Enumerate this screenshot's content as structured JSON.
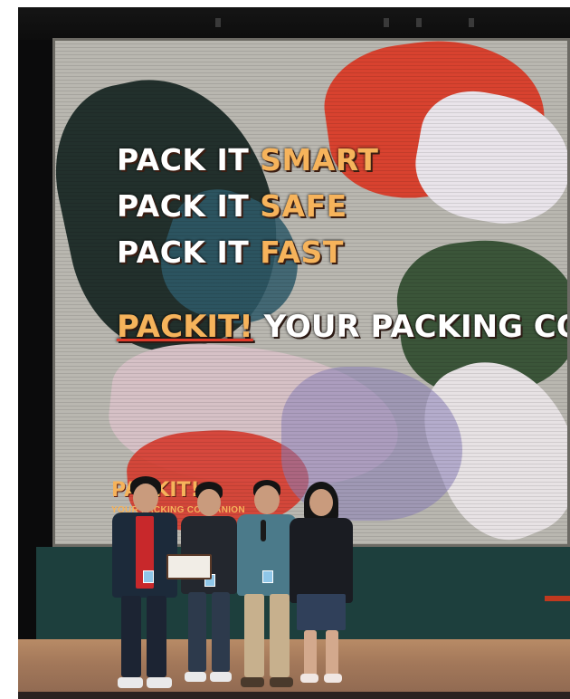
{
  "screen": {
    "headline_lines": [
      {
        "prefix": "PACK IT",
        "accent": "SMART"
      },
      {
        "prefix": "PACK IT",
        "accent": "SAFE"
      },
      {
        "prefix": "PACK IT",
        "accent": "FAST"
      }
    ],
    "tagline_brand": "PACKIT!",
    "tagline_text": "YOUR PACKING CO",
    "logo_small": "PACKIT!",
    "logo_sub": "YOUR PACKING COMPANION"
  },
  "colors": {
    "accent": "#f6b35b",
    "backdrop": "#1d3f3d",
    "floor": "#a3785a"
  }
}
